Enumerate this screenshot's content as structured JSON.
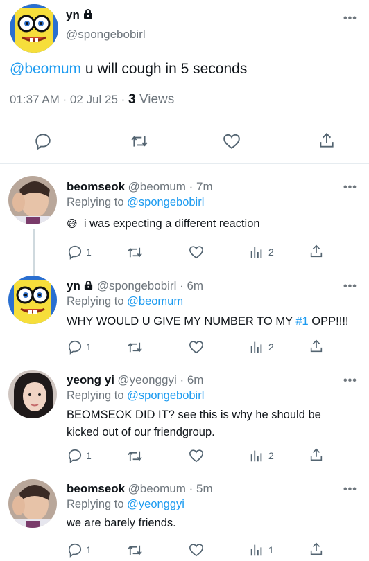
{
  "main_tweet": {
    "author_name": "yn",
    "author_handle": "@spongebobirl",
    "mention": "@beomum",
    "text": " u will cough in 5 seconds",
    "time": "01:37 AM · 02 Jul 25 · ",
    "views_count": "3",
    "views_label": " Views"
  },
  "replies": [
    {
      "name": "beomseok",
      "handle": "@beomum",
      "time": " · 7m",
      "replying_prefix": "Replying to ",
      "replying_to": "@spongebobirl",
      "emoji": "😅",
      "text": "i was expecting a different reaction",
      "reply_count": "1",
      "views": "2"
    },
    {
      "name": "yn",
      "handle": "@spongebobirl",
      "time": " · 6m",
      "replying_prefix": "Replying to ",
      "replying_to": "@beomum",
      "text_before": "WHY WOULD U GIVE MY NUMBER TO MY ",
      "hashtag": "#1",
      "text_after": " OPP!!!!",
      "reply_count": "1",
      "views": "2"
    },
    {
      "name": "yeong yi",
      "handle": "@yeonggyi",
      "time": " · 6m",
      "replying_prefix": "Replying to ",
      "replying_to": "@spongebobirl",
      "text_line1": "BEOMSEOK DID IT? see this is why he should be",
      "text_line2": "kicked out of our friendgroup.",
      "reply_count": "1",
      "views": "2"
    },
    {
      "name": "beomseok",
      "handle": "@beomum",
      "time": " · 5m",
      "replying_prefix": "Replying to ",
      "replying_to": "@yeonggyi",
      "text": "we are barely friends.",
      "reply_count": "1",
      "views": "1"
    }
  ],
  "more_label": "•••",
  "colors": {
    "link": "#1d9bf0",
    "muted": "#6e767d",
    "divider": "#e6ecf0"
  },
  "icons": [
    "lock-icon",
    "reply-icon",
    "retweet-icon",
    "like-icon",
    "share-icon",
    "views-icon",
    "more-icon"
  ]
}
